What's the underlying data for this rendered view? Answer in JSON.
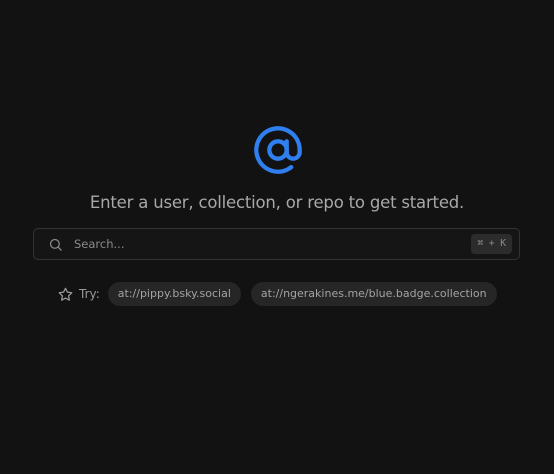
{
  "hero": {
    "icon": "at-sign-icon",
    "accent_color": "#2f7ff0",
    "tagline": "Enter a user, collection, or repo to get started."
  },
  "search": {
    "icon": "search-icon",
    "value": "",
    "placeholder": "Search...",
    "shortcut": "⌘ + K"
  },
  "suggestions": {
    "icon": "star-icon",
    "label": "Try:",
    "items": [
      {
        "label": "at://pippy.bsky.social"
      },
      {
        "label": "at://ngerakines.me/blue.badge.collection"
      }
    ]
  }
}
